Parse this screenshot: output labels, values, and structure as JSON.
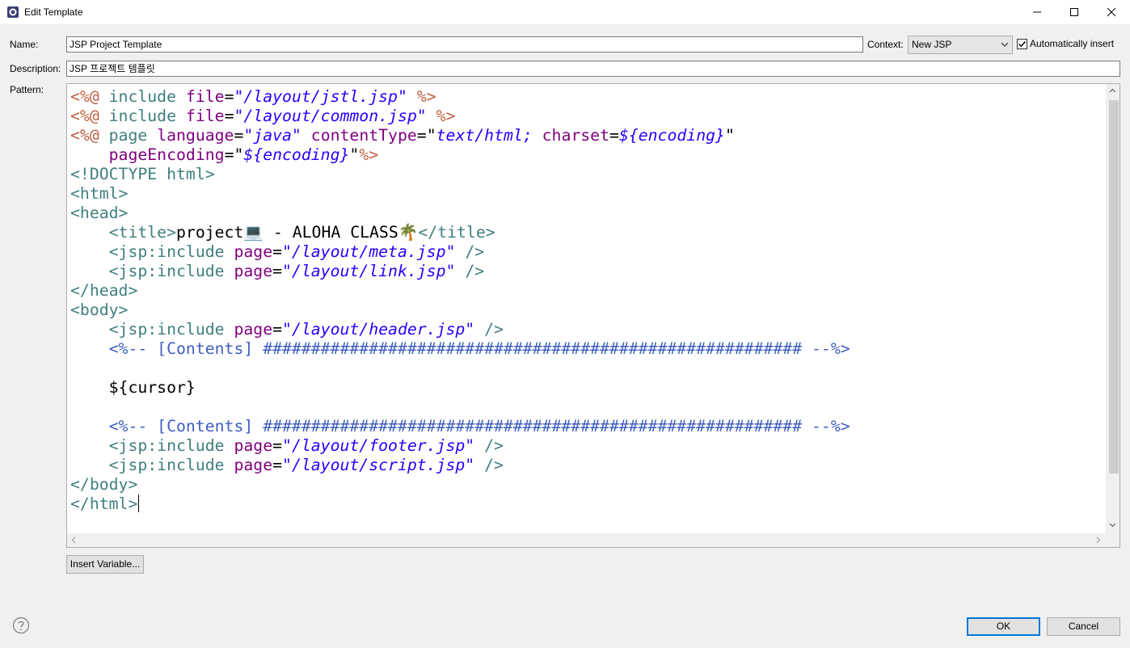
{
  "window": {
    "title": "Edit Template"
  },
  "form": {
    "name_label": "Name:",
    "name_value": "JSP Project Template",
    "context_label": "Context:",
    "context_value": "New JSP",
    "auto_insert_label": "Automatically insert",
    "auto_insert_checked": true,
    "description_label": "Description:",
    "description_value": "JSP 프로젝트 템플릿",
    "pattern_label": "Pattern:"
  },
  "pattern_lines": [
    [
      [
        "d",
        "<%@ "
      ],
      [
        "k",
        "include "
      ],
      [
        "a",
        "file"
      ],
      [
        "t",
        "="
      ],
      [
        "s",
        "\"/layout/jstl.jsp\""
      ],
      [
        "d",
        " %>"
      ]
    ],
    [
      [
        "d",
        "<%@ "
      ],
      [
        "k",
        "include "
      ],
      [
        "a",
        "file"
      ],
      [
        "t",
        "="
      ],
      [
        "s",
        "\"/layout/common.jsp\""
      ],
      [
        "d",
        " %>"
      ]
    ],
    [
      [
        "d",
        "<%@ "
      ],
      [
        "k",
        "page "
      ],
      [
        "a",
        "language"
      ],
      [
        "t",
        "="
      ],
      [
        "s",
        "\"java\""
      ],
      [
        "t",
        " "
      ],
      [
        "a",
        "contentType"
      ],
      [
        "t",
        "=\""
      ],
      [
        "s",
        "text/html; "
      ],
      [
        "a",
        "charset"
      ],
      [
        "t",
        "="
      ],
      [
        "s",
        "${encoding}"
      ],
      [
        "t",
        "\""
      ]
    ],
    [
      [
        "t",
        "    "
      ],
      [
        "a",
        "pageEncoding"
      ],
      [
        "t",
        "=\""
      ],
      [
        "s",
        "${encoding}"
      ],
      [
        "t",
        "\""
      ],
      [
        "d",
        "%>"
      ]
    ],
    [
      [
        "k",
        "<!DOCTYPE html>"
      ]
    ],
    [
      [
        "k",
        "<html>"
      ]
    ],
    [
      [
        "k",
        "<head>"
      ]
    ],
    [
      [
        "t",
        "    "
      ],
      [
        "k",
        "<title>"
      ],
      [
        "t",
        "project💻 - ALOHA CLASS🌴"
      ],
      [
        "k",
        "</title>"
      ]
    ],
    [
      [
        "t",
        "    "
      ],
      [
        "k",
        "<jsp:include "
      ],
      [
        "a",
        "page"
      ],
      [
        "t",
        "="
      ],
      [
        "s",
        "\"/layout/meta.jsp\""
      ],
      [
        "k",
        " />"
      ]
    ],
    [
      [
        "t",
        "    "
      ],
      [
        "k",
        "<jsp:include "
      ],
      [
        "a",
        "page"
      ],
      [
        "t",
        "="
      ],
      [
        "s",
        "\"/layout/link.jsp\""
      ],
      [
        "k",
        " />"
      ]
    ],
    [
      [
        "k",
        "</head>"
      ]
    ],
    [
      [
        "k",
        "<body>"
      ]
    ],
    [
      [
        "t",
        "    "
      ],
      [
        "k",
        "<jsp:include "
      ],
      [
        "a",
        "page"
      ],
      [
        "t",
        "="
      ],
      [
        "s",
        "\"/layout/header.jsp\""
      ],
      [
        "k",
        " />"
      ]
    ],
    [
      [
        "t",
        "    "
      ],
      [
        "c",
        "<%-- [Contents] ######################################################## --%>"
      ]
    ],
    [
      [
        "t",
        ""
      ]
    ],
    [
      [
        "t",
        "    ${cursor}"
      ]
    ],
    [
      [
        "t",
        ""
      ]
    ],
    [
      [
        "t",
        "    "
      ],
      [
        "c",
        "<%-- [Contents] ######################################################## --%>"
      ]
    ],
    [
      [
        "t",
        "    "
      ],
      [
        "k",
        "<jsp:include "
      ],
      [
        "a",
        "page"
      ],
      [
        "t",
        "="
      ],
      [
        "s",
        "\"/layout/footer.jsp\""
      ],
      [
        "k",
        " />"
      ]
    ],
    [
      [
        "t",
        "    "
      ],
      [
        "k",
        "<jsp:include "
      ],
      [
        "a",
        "page"
      ],
      [
        "t",
        "="
      ],
      [
        "s",
        "\"/layout/script.jsp\""
      ],
      [
        "k",
        " />"
      ]
    ],
    [
      [
        "k",
        "</body>"
      ]
    ],
    [
      [
        "k",
        "</html>"
      ]
    ]
  ],
  "buttons": {
    "insert_variable": "Insert Variable...",
    "ok": "OK",
    "cancel": "Cancel"
  },
  "icons": {
    "app": "eclipse-icon",
    "minimize": "minimize-icon",
    "maximize": "maximize-icon",
    "close": "close-icon",
    "help": "help-icon"
  }
}
